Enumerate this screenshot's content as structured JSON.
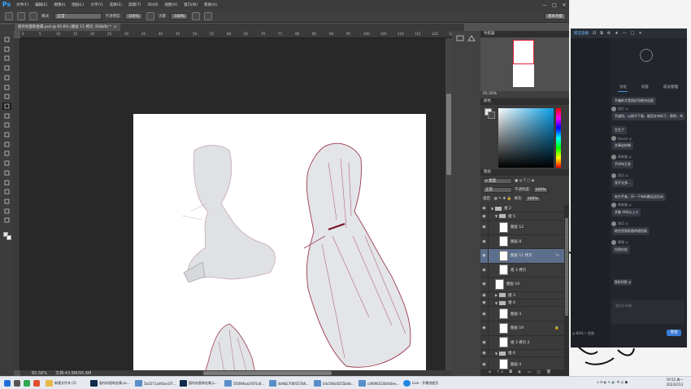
{
  "photoshop": {
    "logo": "Ps",
    "menu": [
      "文件(F)",
      "编辑(E)",
      "图像(I)",
      "图层(L)",
      "文字(Y)",
      "选择(S)",
      "滤镜(T)",
      "3D(D)",
      "视图(V)",
      "窗口(W)",
      "帮助(H)"
    ],
    "window_controls": [
      "—",
      "□",
      "✕"
    ],
    "options": {
      "mode_label": "模式:",
      "mode_value": "正常",
      "opacity_label": "不透明度:",
      "opacity_value": "100%",
      "flow_label": "流量:",
      "flow_value": "100%",
      "workspace": "基本功能"
    },
    "doc_tab": "窗帘封面和金属.psd @ 65.6% (图层 11 拷贝, RGB/8) *",
    "doc_tab_close": "×",
    "ruler_numbers": [
      "0",
      "5",
      "10",
      "15",
      "20",
      "25",
      "30",
      "35",
      "40",
      "45",
      "50",
      "55",
      "60",
      "65",
      "70",
      "75",
      "80",
      "85",
      "90",
      "95",
      "100",
      "105",
      "110",
      "115",
      "120",
      "125"
    ],
    "status": {
      "zoom": "65.56%",
      "doc": "文档:43.6M/95.6M"
    },
    "navigator": {
      "title": "导航器",
      "zoom": "65.56%"
    },
    "color_panel": {
      "title": "颜色"
    },
    "layers_panel": {
      "title": "图层",
      "kind_label": "ρ 类型",
      "blend_mode": "正常",
      "opacity_label": "不透明度:",
      "opacity_value": "100%",
      "lock_label": "锁定:",
      "fill_label": "填充:",
      "fill_value": "100%",
      "footer_icons": "ɷ fx ◘ ◐ ▭ ◫ 🗑",
      "layers": [
        {
          "name": "组 2",
          "type": "group",
          "open": true,
          "indent": 0
        },
        {
          "name": "组 5",
          "type": "group",
          "open": true,
          "indent": 1
        },
        {
          "name": "图层 12",
          "type": "layer",
          "indent": 2,
          "extra": ""
        },
        {
          "name": "图层 8",
          "type": "layer",
          "indent": 2,
          "extra": ""
        },
        {
          "name": "图层 11 拷贝",
          "type": "layer",
          "indent": 2,
          "extra": "fx",
          "selected": true
        },
        {
          "name": "组 3 拷贝",
          "type": "layer",
          "indent": 2,
          "extra": ""
        },
        {
          "name": "图层 10",
          "type": "layer",
          "indent": 1,
          "extra": ""
        },
        {
          "name": "组 3",
          "type": "group",
          "open": false,
          "indent": 1
        },
        {
          "name": "组 4",
          "type": "group",
          "open": true,
          "indent": 1
        },
        {
          "name": "图层 4",
          "type": "layer",
          "indent": 2,
          "extra": ""
        },
        {
          "name": "图层 19",
          "type": "layer",
          "indent": 2,
          "extra": "🔒"
        },
        {
          "name": "组 3 拷贝 2",
          "type": "layer",
          "indent": 2,
          "extra": ""
        },
        {
          "name": "组 6",
          "type": "group",
          "open": true,
          "indent": 1
        },
        {
          "name": "图层 4",
          "type": "layer",
          "indent": 2,
          "extra": ""
        }
      ]
    }
  },
  "stream_app": {
    "title": "鲸选直播",
    "top_icons": [
      "⊟",
      "⧉",
      "⚙",
      "★",
      "—",
      "□",
      "✕"
    ],
    "tabs": [
      "讨论",
      "问答",
      "成员管理"
    ],
    "messages": [
      {
        "user": "",
        "text": "不偏听才是很好用更合适直"
      },
      {
        "user": "池贝 ◎",
        "text": "不遮挡，以前不下垂，能否在布料下，那把，布"
      },
      {
        "user": "",
        "text": "生生了"
      },
      {
        "user": "Seven ◎",
        "text": "文章这样做"
      },
      {
        "user": "咪咪猫 ◎",
        "text": "手印布又多"
      },
      {
        "user": "池贝 ◎",
        "text": "亮不太多..."
      },
      {
        "user": "",
        "text": "有力手来，环一下布料都远远拉动"
      },
      {
        "user": "咪咪猫 ◎",
        "text": "文脑 中间以上小"
      },
      {
        "user": "池贝 ◎",
        "text": "结合里面前面的遮挡面"
      },
      {
        "user": "咪咪 ◎",
        "text": "拉到对应"
      }
    ],
    "reply_btn": "我的问答 ◎",
    "input_placeholder": "说点什么吧...",
    "send_label": "发送",
    "back_stats": "◎ 83%  ⚡ 优质"
  },
  "taskbar": {
    "items": [
      {
        "label": "新建文件夹 (2)",
        "icon": "folder"
      },
      {
        "label": "窗帘封面和金属.ps...",
        "icon": "ps"
      },
      {
        "label": "5b2571a4f4ae1f7...",
        "icon": "img"
      },
      {
        "label": "窗帘封面和金属.p...",
        "icon": "ps"
      },
      {
        "label": "5f2696ae2f3f1c8...",
        "icon": "img"
      },
      {
        "label": "4b9b2706f357b6...",
        "icon": "img"
      },
      {
        "label": "44c566c8255bdb...",
        "icon": "img"
      },
      {
        "label": "c4f696310bfa0ee...",
        "icon": "img"
      },
      {
        "label": "Live - 开播进度页",
        "icon": "edge"
      }
    ],
    "tray": "∧ ✉ ◐ ✦ 🔊 中 ◎ ⬢",
    "time": "19:52 周一",
    "date": "2023/2/13"
  }
}
